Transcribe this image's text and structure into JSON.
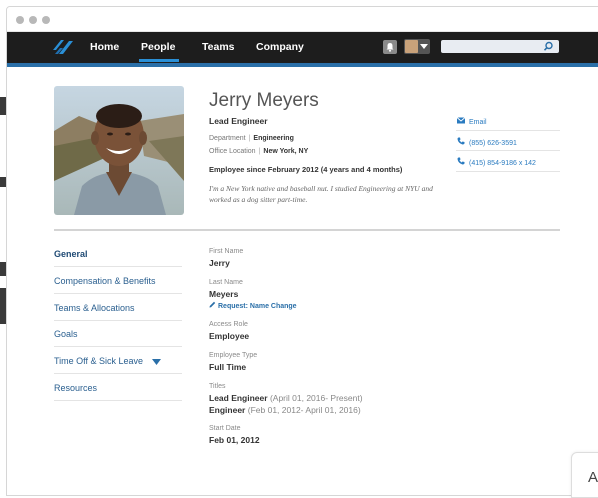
{
  "nav": {
    "links": [
      "Home",
      "People",
      "Teams",
      "Company"
    ],
    "active": "People",
    "search_placeholder": ""
  },
  "profile": {
    "name": "Jerry Meyers",
    "title": "Lead Engineer",
    "department_label": "Department",
    "department": "Engineering",
    "location_label": "Office Location",
    "location": "New York, NY",
    "since": "Employee since February 2012 (4 years and 4 months)",
    "bio": "I'm a New York native and baseball nut. I studied Engineering at NYU and worked as a dog sitter part-time."
  },
  "contact": {
    "email": "Email",
    "phone": "(855) 626-3591",
    "phone_ext": "(415) 854-9186 x 142"
  },
  "sidebar": {
    "items": [
      "General",
      "Compensation & Benefits",
      "Teams & Allocations",
      "Goals",
      "Time Off & Sick Leave",
      "Resources"
    ]
  },
  "details": {
    "first_name_label": "First Name",
    "first_name": "Jerry",
    "last_name_label": "Last Name",
    "last_name": "Meyers",
    "request_link": "Request: Name Change",
    "access_role_label": "Access Role",
    "access_role": "Employee",
    "employee_type_label": "Employee Type",
    "employee_type": "Full Time",
    "titles_label": "Titles",
    "title1": "Lead Engineer",
    "title1_dates": "(April 01, 2016- Present)",
    "title2": "Engineer",
    "title2_dates": "(Feb 01, 2012- April 01, 2016)",
    "start_date_label": "Start Date",
    "start_date": "Feb 01, 2012"
  },
  "corner_letter": "A",
  "colors": {
    "accent": "#2a8fd6",
    "nav_bg": "#1d1d1d",
    "link": "#2a7bc0"
  }
}
